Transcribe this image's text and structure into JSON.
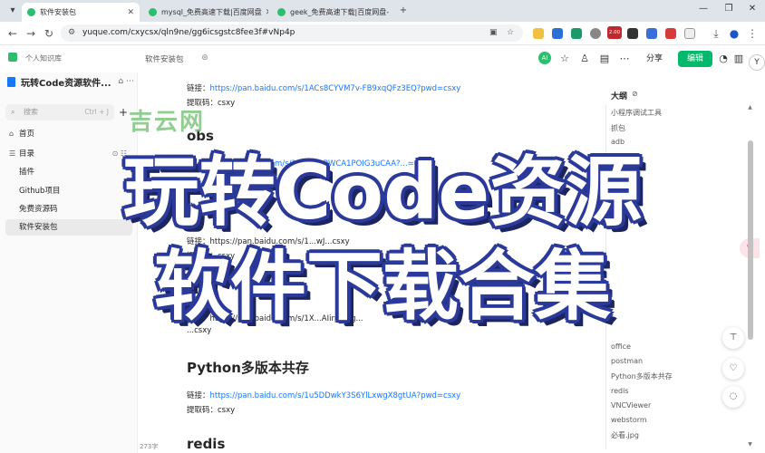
{
  "tabs": [
    {
      "label": "软件安装包",
      "active": true,
      "color": "#2dbd6e"
    },
    {
      "label": "mysql_免费高速下载|百度网盘",
      "active": false,
      "color": "#2dbd6e"
    },
    {
      "label": "geek_免费高速下载|百度网盘-",
      "active": false,
      "color": "#2dbd6e"
    }
  ],
  "address": {
    "url": "yuque.com/cxycsx/qln9ne/gg6icsgstc8fee3f#vNp4p"
  },
  "extensions": {
    "badge": "2.00"
  },
  "header": {
    "personal": "个人知识库",
    "breadcrumb": "软件安装包",
    "avatar": "AI",
    "share": "分享",
    "edit": "编辑"
  },
  "sidebar": {
    "kb_title": "玩转Code资源软件...",
    "search_placeholder": "搜索",
    "search_shortcut": "Ctrl + J",
    "items": [
      {
        "label": "首页",
        "icon": "home-icon",
        "glyph": "⌂"
      },
      {
        "label": "目录",
        "icon": "list-icon",
        "glyph": "☰"
      },
      {
        "label": "插件"
      },
      {
        "label": "Github项目"
      },
      {
        "label": "免费资源码"
      },
      {
        "label": "软件安装包",
        "selected": true
      }
    ],
    "wordcount": "273字"
  },
  "doc": {
    "block1_link_label": "链接：",
    "block1_link": "https://pan.baidu.com/s/1ACs8CYVM7v-FB9xqQFz3EQ?pwd=csxy",
    "block1_code": "提取码：csxy",
    "h_obs": "obs",
    "block2_link_partial": "m/s/1A...v0hBWCA1POIG3uCAA?...=csxy",
    "block3_link_partial": "链接：https://pan.baidu.com/s/1...wJ...csxy",
    "block3_code": "提取码：csxy",
    "h_p": "P...",
    "block4_link": "链接：https://pan.baidu.com/s/1X...AIirpXwg...",
    "block4_code": "...csxy",
    "h_python": "Python多版本共存",
    "block5_link_label": "链接：",
    "block5_link": "https://pan.baidu.com/s/1u5DDwkY3S6YlLxwgX8gtUA?pwd=csxy",
    "block5_code": "提取码：csxy",
    "h_redis": "redis"
  },
  "outline": {
    "title": "大纲",
    "items_top": [
      "小程序调试工具",
      "抓包",
      "adb"
    ],
    "items_bottom": [
      "office",
      "postman",
      "Python多版本共存",
      "redis",
      "VNCViewer",
      "webstorm",
      "必看.jpg"
    ]
  },
  "overlay": {
    "watermark": "吉云网",
    "line1": "玩转Code资源",
    "line2": "软件下载合集"
  },
  "colors": {
    "accent": "#00b96b",
    "link": "#1677ff",
    "overlay_stroke": "#2b3a9a"
  }
}
